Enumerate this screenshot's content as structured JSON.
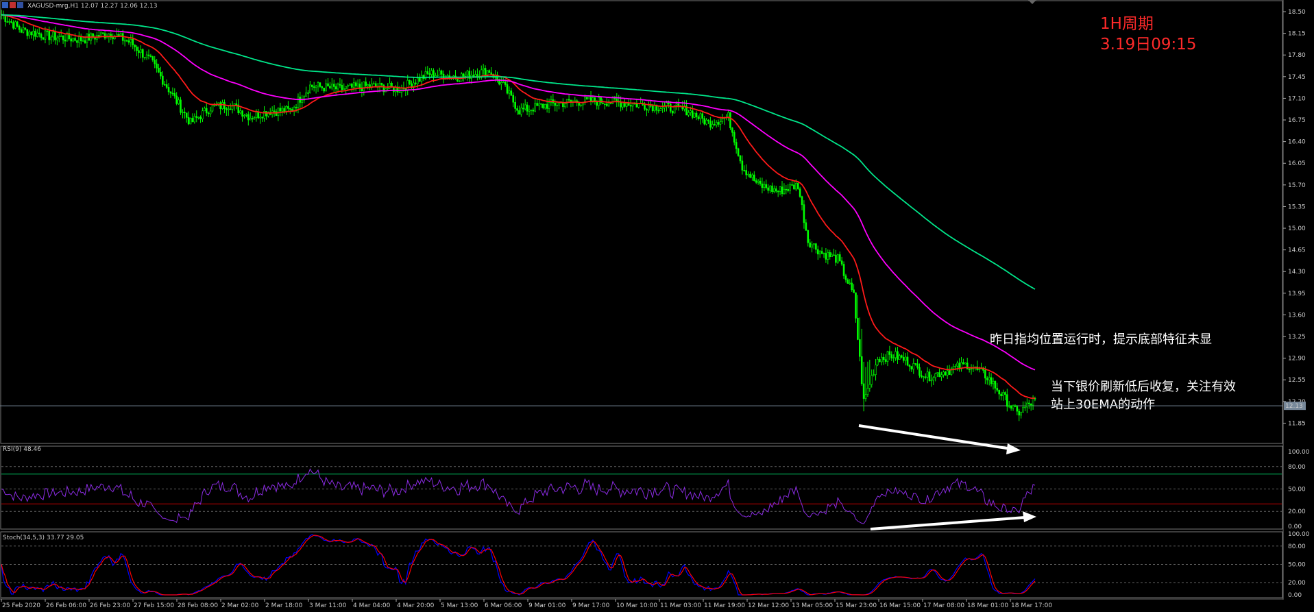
{
  "header": {
    "symbol_line": "XAGUSD-mrg,H1  12.07 12.27 12.06 12.13"
  },
  "overlay_text": {
    "period": "1H周期",
    "timestamp": "3.19日09:15",
    "note1": "昨日指均位置运行时，提示底部特征未显",
    "note2_line1": "当下银价刷新低后收复，关注有效",
    "note2_line2": "站上30EMA的动作"
  },
  "colors": {
    "candle": "#00ff00",
    "ema_fast": "#ff1a1a",
    "ema_mid": "#ff00ff",
    "ema_slow": "#00e68a",
    "rsi_line": "#8a2be2",
    "stoch_main": "#0000ff",
    "stoch_signal": "#ff0000",
    "rsi_upper_level": "#00c060",
    "rsi_lower_level": "#c00000"
  },
  "chart_data": [
    {
      "type": "candlestick",
      "pane": "price",
      "ylim": [
        11.6,
        18.6
      ],
      "y_ticks": [
        "18.50",
        "18.15",
        "17.80",
        "17.45",
        "17.10",
        "16.75",
        "16.40",
        "16.05",
        "15.70",
        "15.35",
        "15.00",
        "14.65",
        "14.30",
        "13.95",
        "13.60",
        "13.25",
        "12.90",
        "12.55",
        "12.20",
        "11.85"
      ],
      "current_price": "12.13",
      "x_ticks": [
        "25 Feb 2020",
        "26 Feb 06:00",
        "26 Feb 23:00",
        "27 Feb 15:00",
        "28 Feb 08:00",
        "2 Mar 02:00",
        "2 Mar 18:00",
        "3 Mar 11:00",
        "4 Mar 04:00",
        "4 Mar 20:00",
        "5 Mar 13:00",
        "6 Mar 06:00",
        "9 Mar 01:00",
        "9 Mar 17:00",
        "10 Mar 10:00",
        "11 Mar 03:00",
        "11 Mar 19:00",
        "12 Mar 12:00",
        "13 Mar 05:00",
        "15 Mar 23:00",
        "16 Mar 15:00",
        "17 Mar 08:00",
        "18 Mar 01:00",
        "18 Mar 17:00"
      ],
      "close_anchors": [
        [
          0,
          18.45
        ],
        [
          10,
          18.2
        ],
        [
          25,
          18.1
        ],
        [
          40,
          18.05
        ],
        [
          55,
          18.15
        ],
        [
          65,
          18.0
        ],
        [
          75,
          17.7
        ],
        [
          85,
          17.2
        ],
        [
          95,
          16.7
        ],
        [
          105,
          16.95
        ],
        [
          115,
          17.0
        ],
        [
          125,
          16.8
        ],
        [
          135,
          16.9
        ],
        [
          145,
          16.9
        ],
        [
          155,
          17.3
        ],
        [
          170,
          17.25
        ],
        [
          185,
          17.3
        ],
        [
          200,
          17.25
        ],
        [
          215,
          17.5
        ],
        [
          230,
          17.45
        ],
        [
          245,
          17.55
        ],
        [
          252,
          17.3
        ],
        [
          260,
          16.9
        ],
        [
          275,
          17.0
        ],
        [
          290,
          17.05
        ],
        [
          305,
          17.05
        ],
        [
          320,
          17.0
        ],
        [
          335,
          16.95
        ],
        [
          345,
          16.9
        ],
        [
          355,
          16.7
        ],
        [
          365,
          16.8
        ],
        [
          372,
          16.0
        ],
        [
          380,
          15.7
        ],
        [
          390,
          15.6
        ],
        [
          400,
          15.7
        ],
        [
          405,
          14.8
        ],
        [
          412,
          14.6
        ],
        [
          420,
          14.5
        ],
        [
          428,
          13.9
        ],
        [
          433,
          12.2
        ],
        [
          440,
          12.9
        ],
        [
          448,
          12.95
        ],
        [
          455,
          12.85
        ],
        [
          465,
          12.6
        ],
        [
          475,
          12.7
        ],
        [
          485,
          12.8
        ],
        [
          495,
          12.6
        ],
        [
          505,
          12.2
        ],
        [
          510,
          12.0
        ],
        [
          518,
          12.2
        ]
      ],
      "series": [
        {
          "name": "",
          "type": "line",
          "smooth_span": 24
        },
        {
          "name": "",
          "type": "line",
          "smooth_span": 75
        },
        {
          "name": "",
          "type": "line",
          "smooth_span": 200
        }
      ]
    },
    {
      "type": "line",
      "pane": "rsi",
      "title": "RSI(9) 48.46",
      "ylim": [
        0,
        100
      ],
      "y_ticks": [
        "100.00",
        "80.00",
        "50.00",
        "20.00",
        "0.00"
      ],
      "levels": [
        70,
        30
      ]
    },
    {
      "type": "line",
      "pane": "stoch",
      "title": "Stoch(34,5,3) 33.77 29.05",
      "ylim": [
        0,
        100
      ],
      "y_ticks": [
        "100.00",
        "80.00",
        "50.00",
        "20.00",
        "0.00"
      ]
    }
  ]
}
